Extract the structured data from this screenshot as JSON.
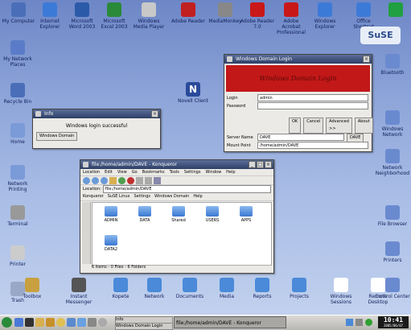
{
  "desktop": {
    "top_icons": [
      {
        "label": "My Computer",
        "color": "#4a6fb8"
      },
      {
        "label": "Internet Explorer",
        "color": "#3c7ad8"
      },
      {
        "label": "Microsoft Word 2003",
        "color": "#2b5aa8"
      },
      {
        "label": "Microsoft Excel 2003",
        "color": "#2a8a3a"
      },
      {
        "label": "Windows Media Player",
        "color": "#c8c8c8"
      },
      {
        "label": "Adobe Reader",
        "color": "#c02020"
      },
      {
        "label": "MediaMonkey",
        "color": "#888888"
      },
      {
        "label": "Adobe Reader 7.0",
        "color": "#c81818"
      },
      {
        "label": "Adobe Acrobat Professional",
        "color": "#c81818"
      },
      {
        "label": "Windows Explorer",
        "color": "#3c7ad8"
      },
      {
        "label": "Office Shortcut",
        "color": "#3c7ad8"
      },
      {
        "label": "",
        "color": "#20a040"
      }
    ],
    "left_icons": [
      {
        "label": "My Network Places",
        "color": "#5a7cc8"
      },
      {
        "label": "Recycle Bin",
        "color": "#4a6fb8"
      },
      {
        "label": "Home",
        "color": "#7a9ad8"
      },
      {
        "label": "Network Printing",
        "color": "#7a9ad8"
      },
      {
        "label": "Terminal",
        "color": "#999999"
      },
      {
        "label": "Printer",
        "color": "#cccccc"
      },
      {
        "label": "Trash",
        "color": "#9aa8c8"
      }
    ],
    "right_icons": [
      {
        "label": "Bluetooth",
        "color": "#6a8ad0"
      },
      {
        "label": "Windows Network",
        "color": "#6a8ad0"
      },
      {
        "label": "Network Neighborhood",
        "color": "#6a8ad0"
      },
      {
        "label": "File Browser",
        "color": "#6a8ad0"
      },
      {
        "label": "Printers",
        "color": "#6a8ad0"
      },
      {
        "label": "Control Center",
        "color": "#6a8ad0"
      }
    ],
    "mid_icon": {
      "label": "Novell Client",
      "color": "#2a4a9a"
    },
    "bottom_icons": [
      {
        "label": "Toolbox",
        "color": "#c8a040"
      },
      {
        "label": "Instant Messenger",
        "color": "#555555"
      },
      {
        "label": "Kopete",
        "color": "#4a8ad8"
      },
      {
        "label": "Network",
        "color": "#4a8ad8"
      },
      {
        "label": "Documents",
        "color": "#4a8ad8"
      },
      {
        "label": "Media",
        "color": "#4a8ad8"
      },
      {
        "label": "Reports",
        "color": "#4a8ad8"
      },
      {
        "label": "Projects",
        "color": "#4a8ad8"
      },
      {
        "label": "Windows Sessions",
        "color": "#ffffff"
      },
      {
        "label": "Remote Desktop",
        "color": "#ffffff"
      }
    ],
    "logo": "SuSE"
  },
  "small_dialog": {
    "title": "Info",
    "message": "Windows login successful",
    "button": "Windows Domain"
  },
  "login_window": {
    "title": "Windows Domain Login",
    "banner": "Windows Domain Login",
    "login_label": "Login",
    "login_value": "admin",
    "password_label": "Password",
    "buttons": [
      "OK",
      "Cancel",
      "Advanced >>",
      "About"
    ],
    "server_label": "Server Name",
    "server_value": "DAVE",
    "mount_label": "Mount Point",
    "mount_value": "/home/admin/DAVE",
    "dave_button": "DAVE"
  },
  "file_window": {
    "title": "file:/home/admin/DAVE - Konqueror",
    "menu": [
      "Location",
      "Edit",
      "View",
      "Go",
      "Bookmarks",
      "Tools",
      "Settings",
      "Window",
      "Help"
    ],
    "address_label": "Location:",
    "address": "file:/home/admin/DAVE",
    "bookmarks": [
      "Konqueror",
      "SuSE Linux",
      "Settings",
      "Windows Domain",
      "Help"
    ],
    "files": [
      "ADMIN",
      "DATA",
      "Shared",
      "USERS",
      "APPS",
      "DATA2"
    ],
    "status": "6 Items - 0 Files - 6 Folders"
  },
  "taskbar": {
    "tasks": [
      "Info",
      "Windows Domain Login",
      "file:/home/admin/DAVE - Konqueror"
    ],
    "clock": "10:41",
    "date": "2005/06/07"
  }
}
